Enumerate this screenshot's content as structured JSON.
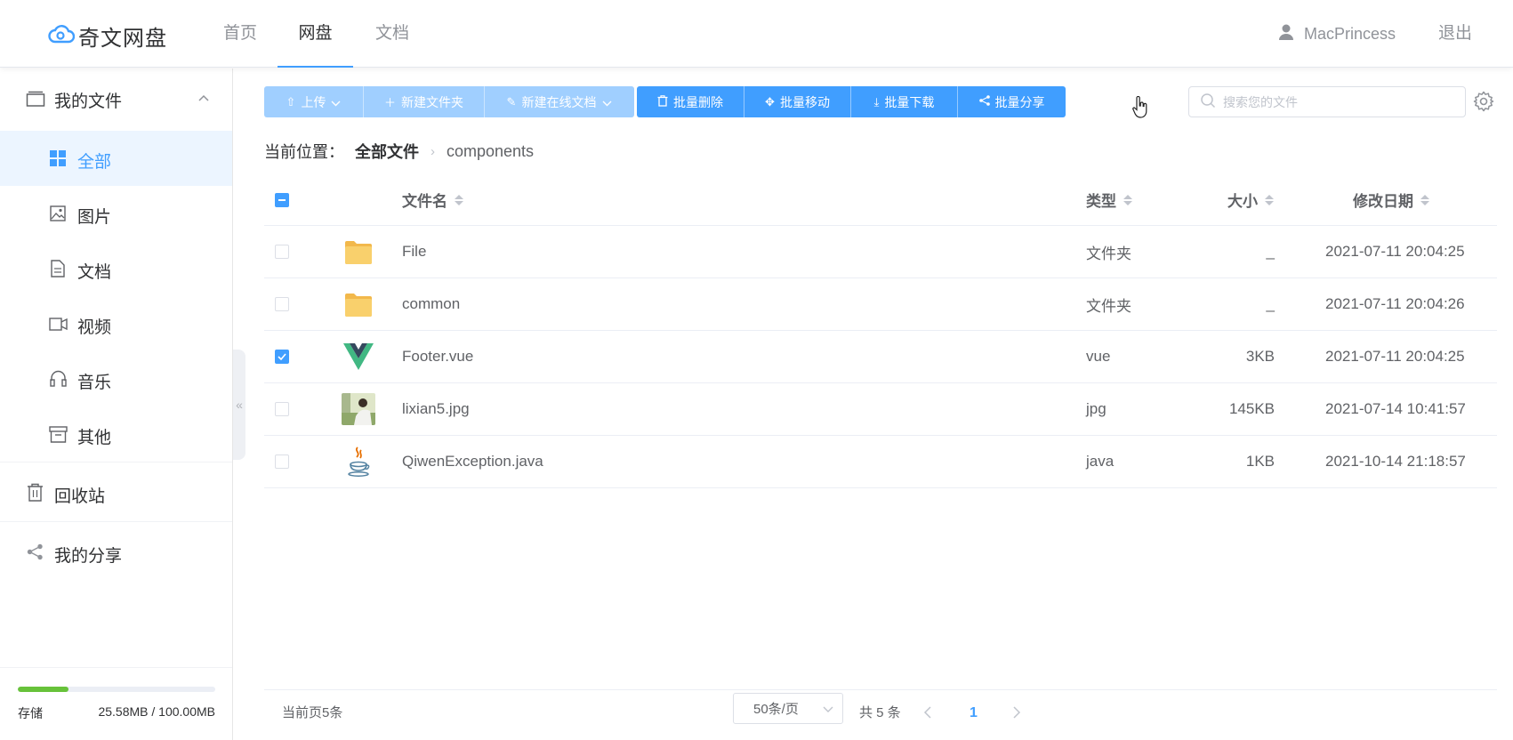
{
  "app": {
    "logo_text": "奇文网盘",
    "nav": [
      {
        "label": "首页",
        "active": false
      },
      {
        "label": "网盘",
        "active": true
      },
      {
        "label": "文档",
        "active": false
      }
    ],
    "username": "MacPrincess",
    "logout_label": "退出"
  },
  "sidebar": {
    "my_files": "我的文件",
    "items": [
      {
        "label": "全部",
        "icon": "grid-icon",
        "active": true
      },
      {
        "label": "图片",
        "icon": "image-icon",
        "active": false
      },
      {
        "label": "文档",
        "icon": "document-icon",
        "active": false
      },
      {
        "label": "视频",
        "icon": "video-icon",
        "active": false
      },
      {
        "label": "音乐",
        "icon": "headphones-icon",
        "active": false
      },
      {
        "label": "其他",
        "icon": "archive-icon",
        "active": false
      }
    ],
    "recycle_bin": "回收站",
    "my_shares": "我的分享",
    "storage": {
      "label": "存储",
      "used_text": "25.58MB / 100.00MB",
      "used_fraction": 0.2558
    }
  },
  "toolbar": {
    "buttons": [
      {
        "label": "上传",
        "icon": "upload-icon",
        "dropdown": true,
        "enabled": false
      },
      {
        "label": "新建文件夹",
        "icon": "plus-icon",
        "dropdown": false,
        "enabled": false
      },
      {
        "label": "新建在线文档",
        "icon": "edit-icon",
        "dropdown": true,
        "enabled": false
      },
      {
        "label": "批量删除",
        "icon": "trash-icon",
        "dropdown": false,
        "enabled": true
      },
      {
        "label": "批量移动",
        "icon": "move-icon",
        "dropdown": false,
        "enabled": true
      },
      {
        "label": "批量下载",
        "icon": "download-icon",
        "dropdown": false,
        "enabled": true
      },
      {
        "label": "批量分享",
        "icon": "share-icon",
        "dropdown": false,
        "enabled": true
      }
    ],
    "search_placeholder": "搜索您的文件"
  },
  "breadcrumb": {
    "label": "当前位置：",
    "items": [
      "全部文件",
      "components"
    ]
  },
  "table": {
    "columns": {
      "name": "文件名",
      "type": "类型",
      "size": "大小",
      "date": "修改日期"
    },
    "rows": [
      {
        "checked": false,
        "icon": "folder-icon",
        "name": "File",
        "type": "文件夹",
        "size": "_",
        "date": "2021-07-11 20:04:25"
      },
      {
        "checked": false,
        "icon": "folder-icon",
        "name": "common",
        "type": "文件夹",
        "size": "_",
        "date": "2021-07-11 20:04:26"
      },
      {
        "checked": true,
        "icon": "vue-icon",
        "name": "Footer.vue",
        "type": "vue",
        "size": "3KB",
        "date": "2021-07-11 20:04:25"
      },
      {
        "checked": false,
        "icon": "photo-thumbnail",
        "name": "lixian5.jpg",
        "type": "jpg",
        "size": "145KB",
        "date": "2021-07-14 10:41:57"
      },
      {
        "checked": false,
        "icon": "java-icon",
        "name": "QiwenException.java",
        "type": "java",
        "size": "1KB",
        "date": "2021-10-14 21:18:57"
      }
    ]
  },
  "pagination": {
    "current_page_count": "当前页5条",
    "page_size": "50条/页",
    "total": "共 5 条",
    "current_page": "1"
  },
  "colors": {
    "primary": "#409eff",
    "primary_light": "#a0cfff",
    "storage_bar": "#67c23a",
    "folder": "#f7c453"
  }
}
